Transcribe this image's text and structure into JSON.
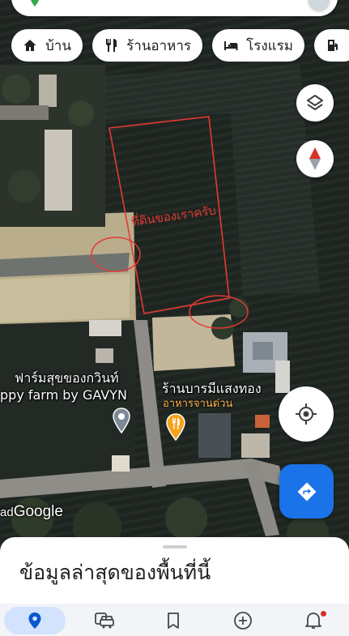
{
  "search": {
    "avatar_icon": "avatar-icon"
  },
  "chips": [
    {
      "label": "บ้าน",
      "icon": "home-icon"
    },
    {
      "label": "ร้านอาหาร",
      "icon": "restaurant-icon"
    },
    {
      "label": "โรงแรม",
      "icon": "hotel-icon"
    },
    {
      "label": "",
      "icon": "gas-station-icon"
    }
  ],
  "map": {
    "annotation": "ที่ดินของเราครับ",
    "places": [
      {
        "name_line1": "ฟาร์มสุขของกวินท์",
        "name_line2": "ppy farm by GAVYN"
      },
      {
        "name_line1": "ร้านบารมีแสงทอง",
        "category": "อาหารจานด่วน"
      }
    ],
    "attribution_prefix": "ad",
    "logo": "Google",
    "annotation_color": "#e53935"
  },
  "buttons": {
    "layers": "layers-icon",
    "compass": "compass-icon",
    "locate": "my-location-icon",
    "directions": "directions-icon",
    "accent": "#1a73e8"
  },
  "sheet": {
    "title": "ข้อมูลล่าสุดของพื้นที่นี้"
  },
  "nav": [
    {
      "icon": "explore-pin-icon",
      "active": true
    },
    {
      "icon": "commute-icon",
      "active": false
    },
    {
      "icon": "saved-icon",
      "active": false
    },
    {
      "icon": "contribute-icon",
      "active": false
    },
    {
      "icon": "updates-bell-icon",
      "active": false,
      "badge": true
    }
  ]
}
